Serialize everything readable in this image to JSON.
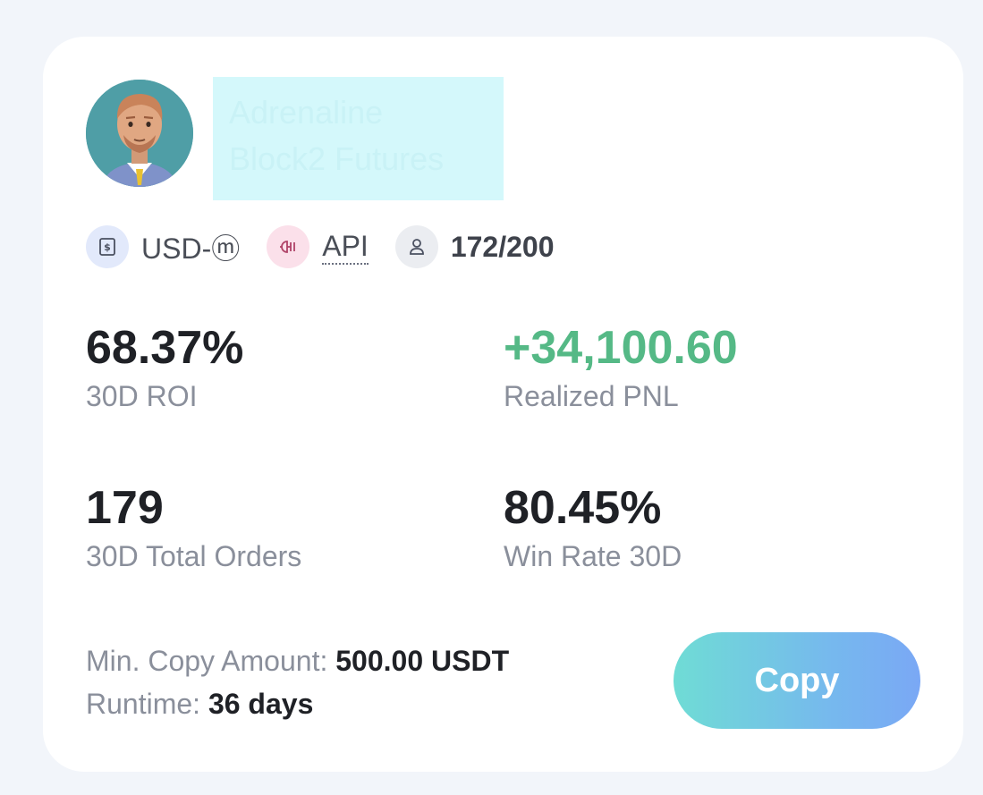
{
  "trader": {
    "name_line1": "Adrenaline",
    "name_line2": "Block2 Futures",
    "avatar_icon": "trader-avatar-icon"
  },
  "tags": {
    "market": {
      "label": "USD-ⓜ",
      "icon": "usd-margin-icon"
    },
    "api": {
      "label": "API",
      "icon": "api-plug-icon"
    },
    "copiers": {
      "label": "172/200",
      "icon": "user-icon"
    }
  },
  "stats": {
    "roi": {
      "value": "68.37%",
      "label": "30D ROI"
    },
    "pnl": {
      "value": "+34,100.60",
      "label": "Realized PNL"
    },
    "orders": {
      "value": "179",
      "label": "30D Total Orders"
    },
    "win_rate": {
      "value": "80.45%",
      "label": "Win Rate 30D"
    }
  },
  "info": {
    "min_copy_label": "Min. Copy Amount: ",
    "min_copy_value": "500.00 USDT",
    "runtime_label": "Runtime: ",
    "runtime_value": "36 days"
  },
  "copy_button": {
    "label": "Copy"
  },
  "colors": {
    "positive": "#55b986",
    "button_gradient_start": "#6fdcd5",
    "button_gradient_end": "#7aa8f5"
  }
}
